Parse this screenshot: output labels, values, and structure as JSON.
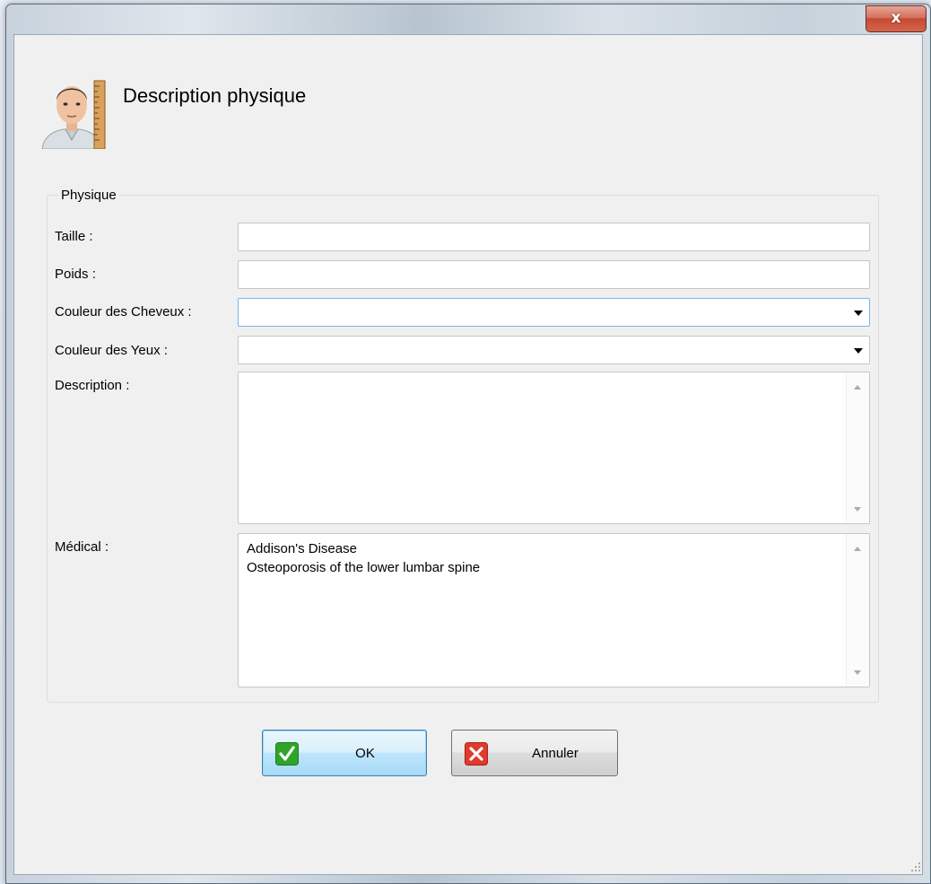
{
  "window": {
    "close_glyph": "x"
  },
  "header": {
    "title": "Description physique",
    "icon": "person-with-ruler-icon"
  },
  "physique_group": {
    "legend": "Physique",
    "taille": {
      "label": "Taille :",
      "value": ""
    },
    "poids": {
      "label": "Poids :",
      "value": ""
    },
    "couleur_cheveux": {
      "label": "Couleur des Cheveux :",
      "value": ""
    },
    "couleur_yeux": {
      "label": "Couleur des Yeux :",
      "value": ""
    },
    "description": {
      "label": "Description :",
      "value": ""
    },
    "medical": {
      "label": "Médical :",
      "value": "Addison's Disease\nOsteoporosis of the lower lumbar spine"
    }
  },
  "buttons": {
    "ok": {
      "label": "OK",
      "icon": "check-icon",
      "color": "#2ea52a"
    },
    "cancel": {
      "label": "Annuler",
      "icon": "x-icon",
      "color": "#e0392d"
    }
  }
}
